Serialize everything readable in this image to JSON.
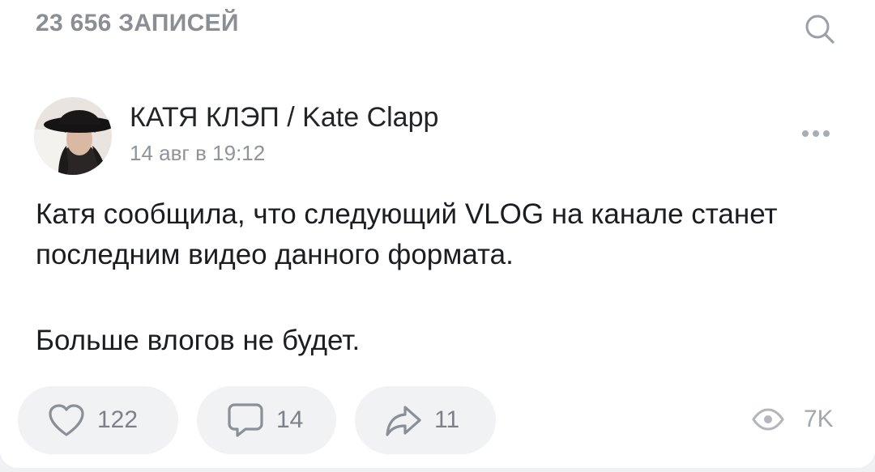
{
  "header": {
    "records_count": "23 656 ЗАПИСЕЙ",
    "search_icon": "search-icon"
  },
  "post": {
    "author": "КАТЯ КЛЭП / Kate Clapp",
    "date": "14 авг в 19:12",
    "paragraphs": [
      "Катя сообщила, что следующий VLOG на канале станет последним видео данного формата.",
      "Больше влогов не будет."
    ],
    "more_icon": "more-horizontal-icon"
  },
  "actions": {
    "likes": "122",
    "comments": "14",
    "shares": "11",
    "views": "7K"
  },
  "colors": {
    "background": "#f0f1f3",
    "card": "#ffffff",
    "muted_text": "#8a8f96",
    "primary_text": "#1c1d20",
    "pill": "#f1f2f4"
  }
}
